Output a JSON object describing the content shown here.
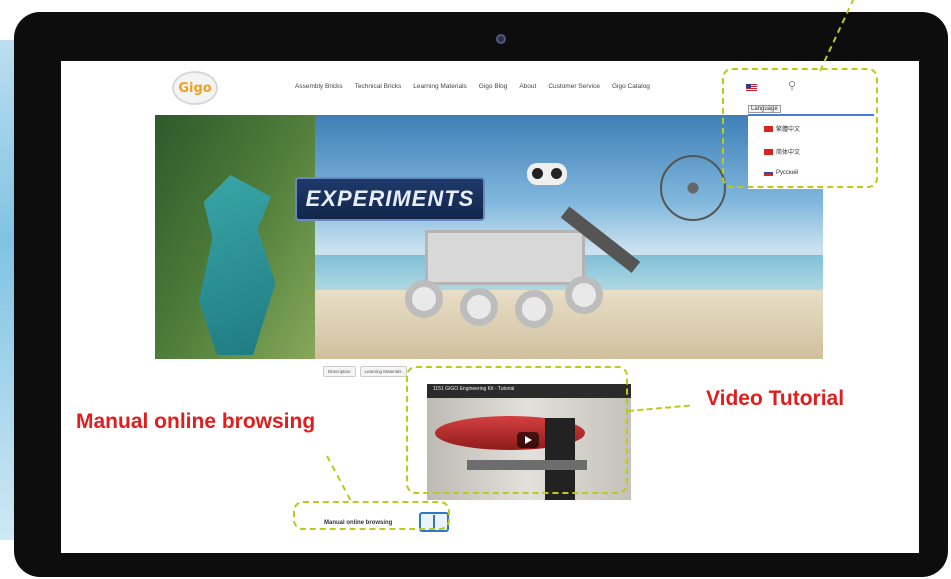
{
  "nav": {
    "logo_text": "Gigo",
    "items": [
      "Assembly Bricks",
      "Technical Bricks",
      "Learning Materials",
      "Gigo Blog",
      "About",
      "Customer Service",
      "Gigo Catalog"
    ]
  },
  "language": {
    "label": "Language",
    "options": [
      "繁體中文",
      "简体中文",
      "Русский"
    ]
  },
  "hero": {
    "banner_text": "EXPERIMENTS"
  },
  "sub_tabs": [
    "Description",
    "Learning Materials"
  ],
  "video": {
    "title": "1151 GIGO Engineering Kit - Tutorial"
  },
  "manual": {
    "link_text": "Manual online browsing"
  },
  "callouts": {
    "video_tutorial": "Video Tutorial",
    "manual_online": "Manual online browsing"
  },
  "colors": {
    "callout_text": "#e11d1d",
    "callout_border": "#b9cc1e",
    "monitor": "#0d0d0d"
  },
  "icons": [
    "camera-icon",
    "apple-icon",
    "search-icon",
    "us-flag-icon",
    "book-icon",
    "play-icon"
  ]
}
